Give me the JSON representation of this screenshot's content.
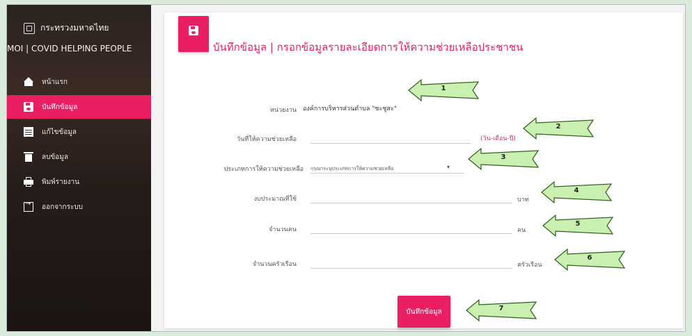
{
  "sidebar": {
    "brand_title": "กระทรวงมหาดไทย",
    "brand_sub": "MOI | COVID HELPING PEOPLE",
    "items": [
      {
        "label": "หน้าแรก",
        "icon": "home-icon"
      },
      {
        "label": "บันทึกข้อมูล",
        "icon": "save-icon"
      },
      {
        "label": "แก้ไขข้อมูล",
        "icon": "doc-icon"
      },
      {
        "label": "ลบข้อมูล",
        "icon": "trash-icon"
      },
      {
        "label": "พิมพ์รายงาน",
        "icon": "print-icon"
      },
      {
        "label": "ออกจากระบบ",
        "icon": "logout-icon"
      }
    ]
  },
  "header": {
    "title": "บันทึกข้อมูล | กรอกข้อมูลรายละเอียดการให้ความช่วยเหลือประชาชน"
  },
  "form": {
    "agency_label": "หน่วยงาน",
    "agency_value": "องค์การบริหารส่วนตำบล \"ชะชูสะ\"",
    "date_label": "วันที่ให้ความช่วยเหลือ",
    "date_value": "",
    "date_hint": "(วัน-เดือน-ปี)",
    "type_label": "ประเภทการให้ความช่วยเหลือ",
    "type_selected": "กรุณาระบุประเภทการให้ความช่วยเหลือ",
    "budget_label": "งบประมาณที่ใช้",
    "budget_value": "",
    "budget_unit": "บาท",
    "people_label": "จำนวนคน",
    "people_value": "",
    "people_unit": "คน",
    "households_label": "จำนวนครัวเรือน",
    "households_value": "",
    "households_unit": "ครัวเรือน",
    "save_label": "บันทึกข้อมูล"
  },
  "annotations": [
    "1",
    "2",
    "3",
    "4",
    "5",
    "6",
    "7"
  ],
  "colors": {
    "accent": "#e91e63",
    "arrow_fill": "#c9f0b0",
    "arrow_stroke": "#2f5f1e",
    "page_bg": "#d9ecdc"
  }
}
